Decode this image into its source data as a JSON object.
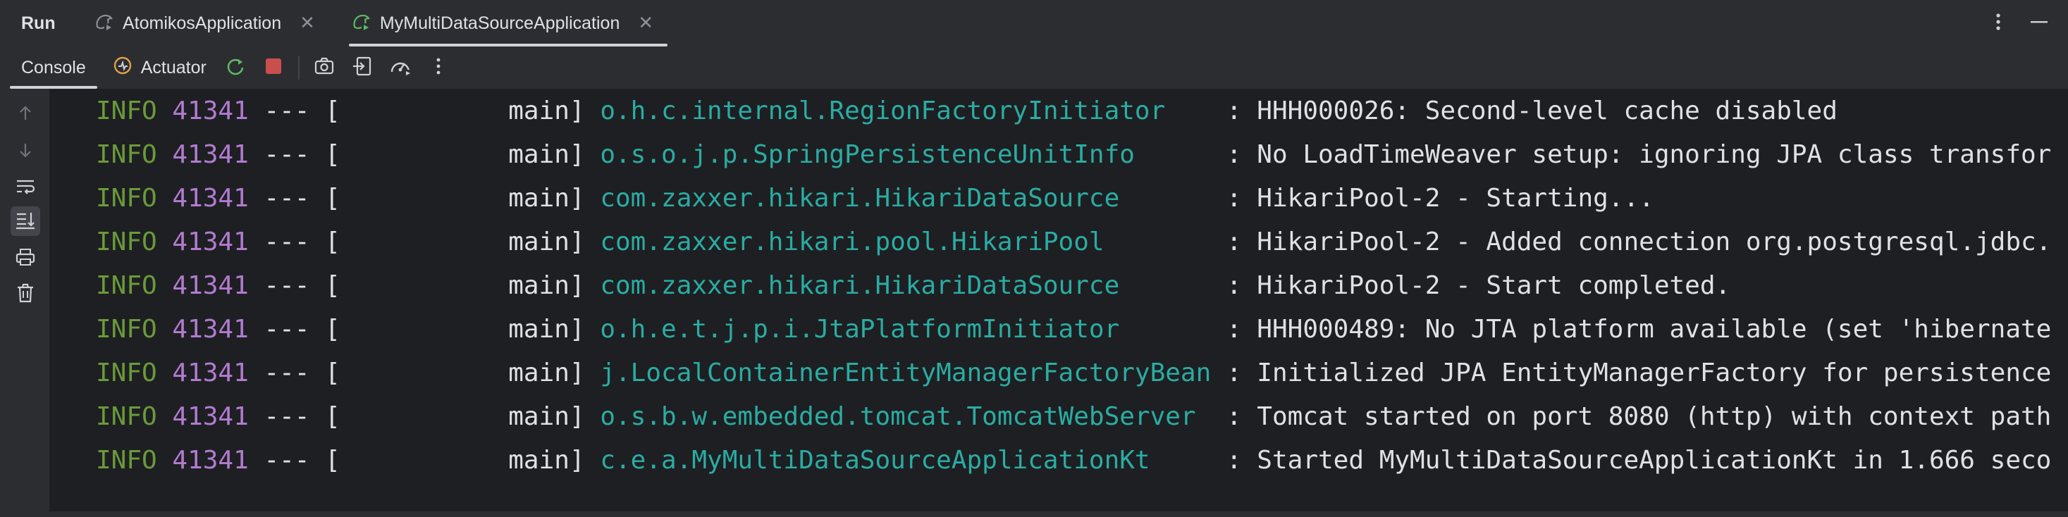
{
  "titlebar": {
    "run_label": "Run",
    "tabs": [
      {
        "label": "AtomikosApplication",
        "active": false
      },
      {
        "label": "MyMultiDataSourceApplication",
        "active": true
      }
    ]
  },
  "toolbar": {
    "tabs": [
      {
        "label": "Console",
        "active": true
      },
      {
        "label": "Actuator",
        "active": false
      }
    ]
  },
  "console": {
    "lines": [
      {
        "level": "INFO",
        "pid": "41341",
        "sep": "---",
        "thread": "[           main]",
        "logger": "o.h.c.internal.RegionFactoryInitiator   ",
        "msg": " : HHH000026: Second-level cache disabled"
      },
      {
        "level": "INFO",
        "pid": "41341",
        "sep": "---",
        "thread": "[           main]",
        "logger": "o.s.o.j.p.SpringPersistenceUnitInfo     ",
        "msg": " : No LoadTimeWeaver setup: ignoring JPA class transfor"
      },
      {
        "level": "INFO",
        "pid": "41341",
        "sep": "---",
        "thread": "[           main]",
        "logger": "com.zaxxer.hikari.HikariDataSource      ",
        "msg": " : HikariPool-2 - Starting..."
      },
      {
        "level": "INFO",
        "pid": "41341",
        "sep": "---",
        "thread": "[           main]",
        "logger": "com.zaxxer.hikari.pool.HikariPool       ",
        "msg": " : HikariPool-2 - Added connection org.postgresql.jdbc."
      },
      {
        "level": "INFO",
        "pid": "41341",
        "sep": "---",
        "thread": "[           main]",
        "logger": "com.zaxxer.hikari.HikariDataSource      ",
        "msg": " : HikariPool-2 - Start completed."
      },
      {
        "level": "INFO",
        "pid": "41341",
        "sep": "---",
        "thread": "[           main]",
        "logger": "o.h.e.t.j.p.i.JtaPlatformInitiator      ",
        "msg": " : HHH000489: No JTA platform available (set 'hibernate"
      },
      {
        "level": "INFO",
        "pid": "41341",
        "sep": "---",
        "thread": "[           main]",
        "logger": "j.LocalContainerEntityManagerFactoryBean",
        "msg": " : Initialized JPA EntityManagerFactory for persistence"
      },
      {
        "level": "INFO",
        "pid": "41341",
        "sep": "---",
        "thread": "[           main]",
        "logger": "o.s.b.w.embedded.tomcat.TomcatWebServer ",
        "msg": " : Tomcat started on port 8080 (http) with context path"
      },
      {
        "level": "INFO",
        "pid": "41341",
        "sep": "---",
        "thread": "[           main]",
        "logger": "c.e.a.MyMultiDataSourceApplicationKt    ",
        "msg": " : Started MyMultiDataSourceApplicationKt in 1.666 seco"
      }
    ]
  },
  "colors": {
    "background": "#1e1f22",
    "panel": "#2b2d30",
    "level": "#6a9a3a",
    "pid": "#b27bd1",
    "logger": "#2aaca3",
    "text": "#dfe1e5",
    "stop": "#c94f4f",
    "rerun": "#5fb865"
  },
  "icons": {
    "run_config": "spring-boot-run-icon",
    "actuator": "actuator-icon",
    "rerun": "rerun-icon",
    "stop": "stop-icon",
    "screenshot": "camera-icon",
    "restore_layout": "exit-icon",
    "profiler": "gauge-icon",
    "more": "more-vertical-icon",
    "minimize": "minimize-icon",
    "scroll_up": "arrow-up-icon",
    "scroll_down": "arrow-down-icon",
    "soft_wrap": "soft-wrap-icon",
    "scroll_to_end": "scroll-to-end-icon",
    "print": "print-icon",
    "clear": "trash-icon"
  }
}
